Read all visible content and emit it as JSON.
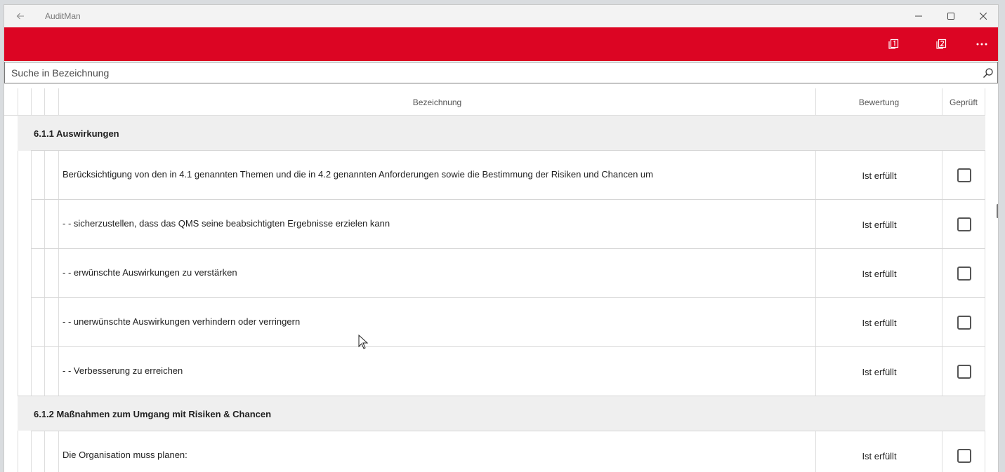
{
  "app": {
    "title": "AuditMan"
  },
  "colors": {
    "accent": "#dc0523"
  },
  "icons": {
    "back": "arrow-left-icon",
    "minimize": "minimize-icon",
    "maximize": "maximize-icon",
    "close": "close-icon",
    "page1": "page-one-icon",
    "page2": "page-two-icon",
    "more": "more-icon",
    "search": "search-icon"
  },
  "search": {
    "placeholder": "Suche in Bezeichnung",
    "value": ""
  },
  "table": {
    "columns": {
      "name": "Bezeichnung",
      "rating": "Bewertung",
      "checked": "Geprüft"
    },
    "groups": [
      {
        "title": "6.1.1 Auswirkungen",
        "rows": [
          {
            "text": "Berücksichtigung von den in 4.1 genannten Themen und die in 4.2 genannten Anforderungen sowie die Bestimmung der Risiken und Chancen um",
            "rating": "Ist erfüllt",
            "checked": false
          },
          {
            "text": "- - sicherzustellen, dass das QMS seine beabsichtigten Ergebnisse erzielen kann",
            "rating": "Ist erfüllt",
            "checked": false
          },
          {
            "text": "- - erwünschte Auswirkungen zu verstärken",
            "rating": "Ist erfüllt",
            "checked": false
          },
          {
            "text": "- - unerwünschte Auswirkungen verhindern oder verringern",
            "rating": "Ist erfüllt",
            "checked": false
          },
          {
            "text": "- - Verbesserung zu erreichen",
            "rating": "Ist erfüllt",
            "checked": false
          }
        ]
      },
      {
        "title": "6.1.2 Maßnahmen zum Umgang mit Risiken & Chancen",
        "rows": [
          {
            "text": "Die Organisation muss planen:",
            "rating": "Ist erfüllt",
            "checked": false
          }
        ]
      }
    ]
  }
}
